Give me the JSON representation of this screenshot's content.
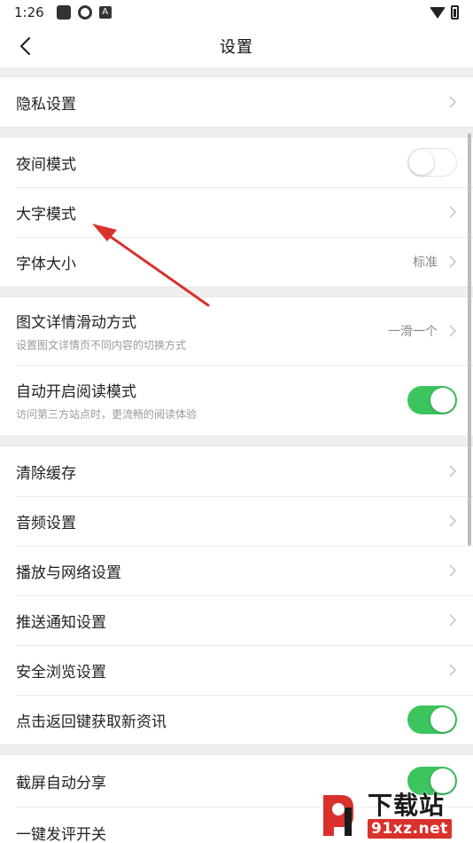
{
  "status_bar": {
    "time": "1:26"
  },
  "header": {
    "title": "设置"
  },
  "groups": [
    {
      "rows": [
        {
          "label": "隐私设置"
        }
      ]
    },
    {
      "rows": [
        {
          "label": "夜间模式",
          "toggle": "off"
        },
        {
          "label": "大字模式"
        },
        {
          "label": "字体大小",
          "value": "标准"
        }
      ]
    },
    {
      "rows": [
        {
          "label": "图文详情滑动方式",
          "subtitle": "设置图文详情页不同内容的切换方式",
          "value": "一滑一个"
        },
        {
          "label": "自动开启阅读模式",
          "subtitle": "访问第三方站点时，更流畅的阅读体验",
          "toggle": "on"
        }
      ]
    },
    {
      "rows": [
        {
          "label": "清除缓存"
        },
        {
          "label": "音频设置"
        },
        {
          "label": "播放与网络设置"
        },
        {
          "label": "推送通知设置"
        },
        {
          "label": "安全浏览设置"
        },
        {
          "label": "点击返回键获取新资讯",
          "toggle": "on"
        }
      ]
    },
    {
      "rows": [
        {
          "label": "截屏自动分享",
          "toggle": "on"
        },
        {
          "label": "一键发评开关"
        }
      ]
    }
  ],
  "watermark": {
    "title": "下载站",
    "url": "91xz.net"
  },
  "colors": {
    "toggle_on": "#3cc45e",
    "annotation_arrow": "#d9312b"
  }
}
